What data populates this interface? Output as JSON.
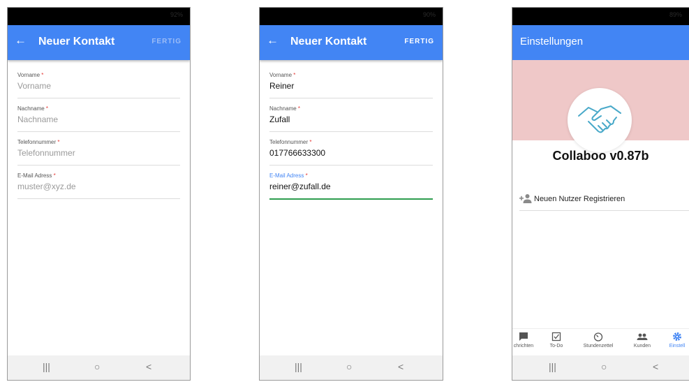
{
  "screens": [
    {
      "status": "92%",
      "appbar": {
        "back_icon": "arrow-left-icon",
        "title": "Neuer Kontakt",
        "action": "FERTIG"
      },
      "fields": [
        {
          "label": "Vorname",
          "placeholder": "Vorname",
          "value": ""
        },
        {
          "label": "Nachname",
          "placeholder": "Nachname",
          "value": ""
        },
        {
          "label": "Telefonnummer",
          "placeholder": "Telefonnummer",
          "value": ""
        },
        {
          "label": "E-Mail Adress",
          "placeholder": "muster@xyz.de",
          "value": ""
        }
      ],
      "required_marker": "*"
    },
    {
      "status": "90%",
      "appbar": {
        "back_icon": "arrow-left-icon",
        "title": "Neuer Kontakt",
        "action": "FERTIG"
      },
      "fields": [
        {
          "label": "Vorname",
          "value": "Reiner"
        },
        {
          "label": "Nachname",
          "value": "Zufall"
        },
        {
          "label": "Telefonnummer",
          "value": "017766633300"
        },
        {
          "label": "E-Mail Adress",
          "value": "reiner@zufall.de",
          "focused": true
        }
      ],
      "required_marker": "*"
    },
    {
      "status": "89%",
      "appbar": {
        "title": "Einstellungen"
      },
      "logo_icon": "handshake-icon",
      "app_name": "Collaboo v0.87b",
      "register": {
        "icon": "person-add-icon",
        "label": "Neuen Nutzer Registrieren"
      },
      "tabs": [
        {
          "label": "chrichten",
          "icon": "chat-icon"
        },
        {
          "label": "To-Do",
          "icon": "checkbox-icon"
        },
        {
          "label": "Stundenzettel",
          "icon": "timer-icon"
        },
        {
          "label": "Kunden",
          "icon": "people-icon"
        },
        {
          "label": "Einstell",
          "icon": "gear-icon",
          "active": true
        }
      ]
    }
  ],
  "system_nav": {
    "recents": "|||",
    "home": "○",
    "back": "<"
  },
  "colors": {
    "primary": "#4285f4",
    "hero": "#efc8c8",
    "focus_line": "#2e9d4f",
    "required": "#e53935"
  }
}
